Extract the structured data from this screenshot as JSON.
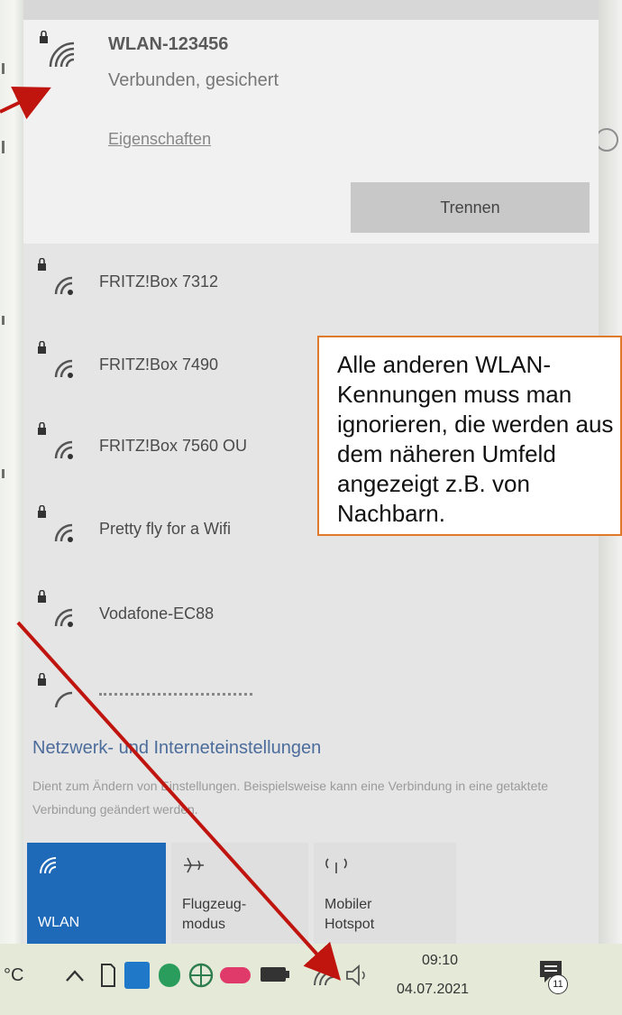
{
  "connected_network": {
    "ssid": "WLAN-123456",
    "status": "Verbunden, gesichert",
    "properties_link": "Eigenschaften",
    "disconnect_button": "Trennen"
  },
  "networks": [
    {
      "name": "FRITZ!Box 7312"
    },
    {
      "name": "FRITZ!Box 7490"
    },
    {
      "name": "FRITZ!Box 7560 OU"
    },
    {
      "name": "Pretty fly for a Wifi"
    },
    {
      "name": "Vodafone-EC88"
    }
  ],
  "network_settings": {
    "title": "Netzwerk- und Interneteinstellungen",
    "description": "Dient zum Ändern von Einstellungen. Beispielsweise kann eine Verbindung in eine getaktete Verbindung geändert werden."
  },
  "quick_actions": {
    "wlan": "WLAN",
    "airplane_line1": "Flugzeug-",
    "airplane_line2": "modus",
    "hotspot_line1": "Mobiler",
    "hotspot_line2": "Hotspot"
  },
  "taskbar": {
    "temperature_unit": "°C",
    "time": "09:10",
    "date": "04.07.2021",
    "notification_count": "11",
    "icons": [
      "chevron-up-icon",
      "file-icon",
      "outlook-icon",
      "shield-icon",
      "network-globe-icon",
      "cloud-icon",
      "battery-icon",
      "wifi-icon",
      "speaker-icon",
      "notification-icon"
    ]
  },
  "callout": {
    "text": "Alle anderen WLAN-Kennungen muss man ignorieren, die werden aus dem näheren Umfeld angezeigt z.B. von Nachbarn."
  },
  "colors": {
    "arrow": "#c0140f",
    "wlan_tile": "#1f6ab8",
    "callout_border": "#e07a2a",
    "settings_link": "#4c6c9c"
  }
}
